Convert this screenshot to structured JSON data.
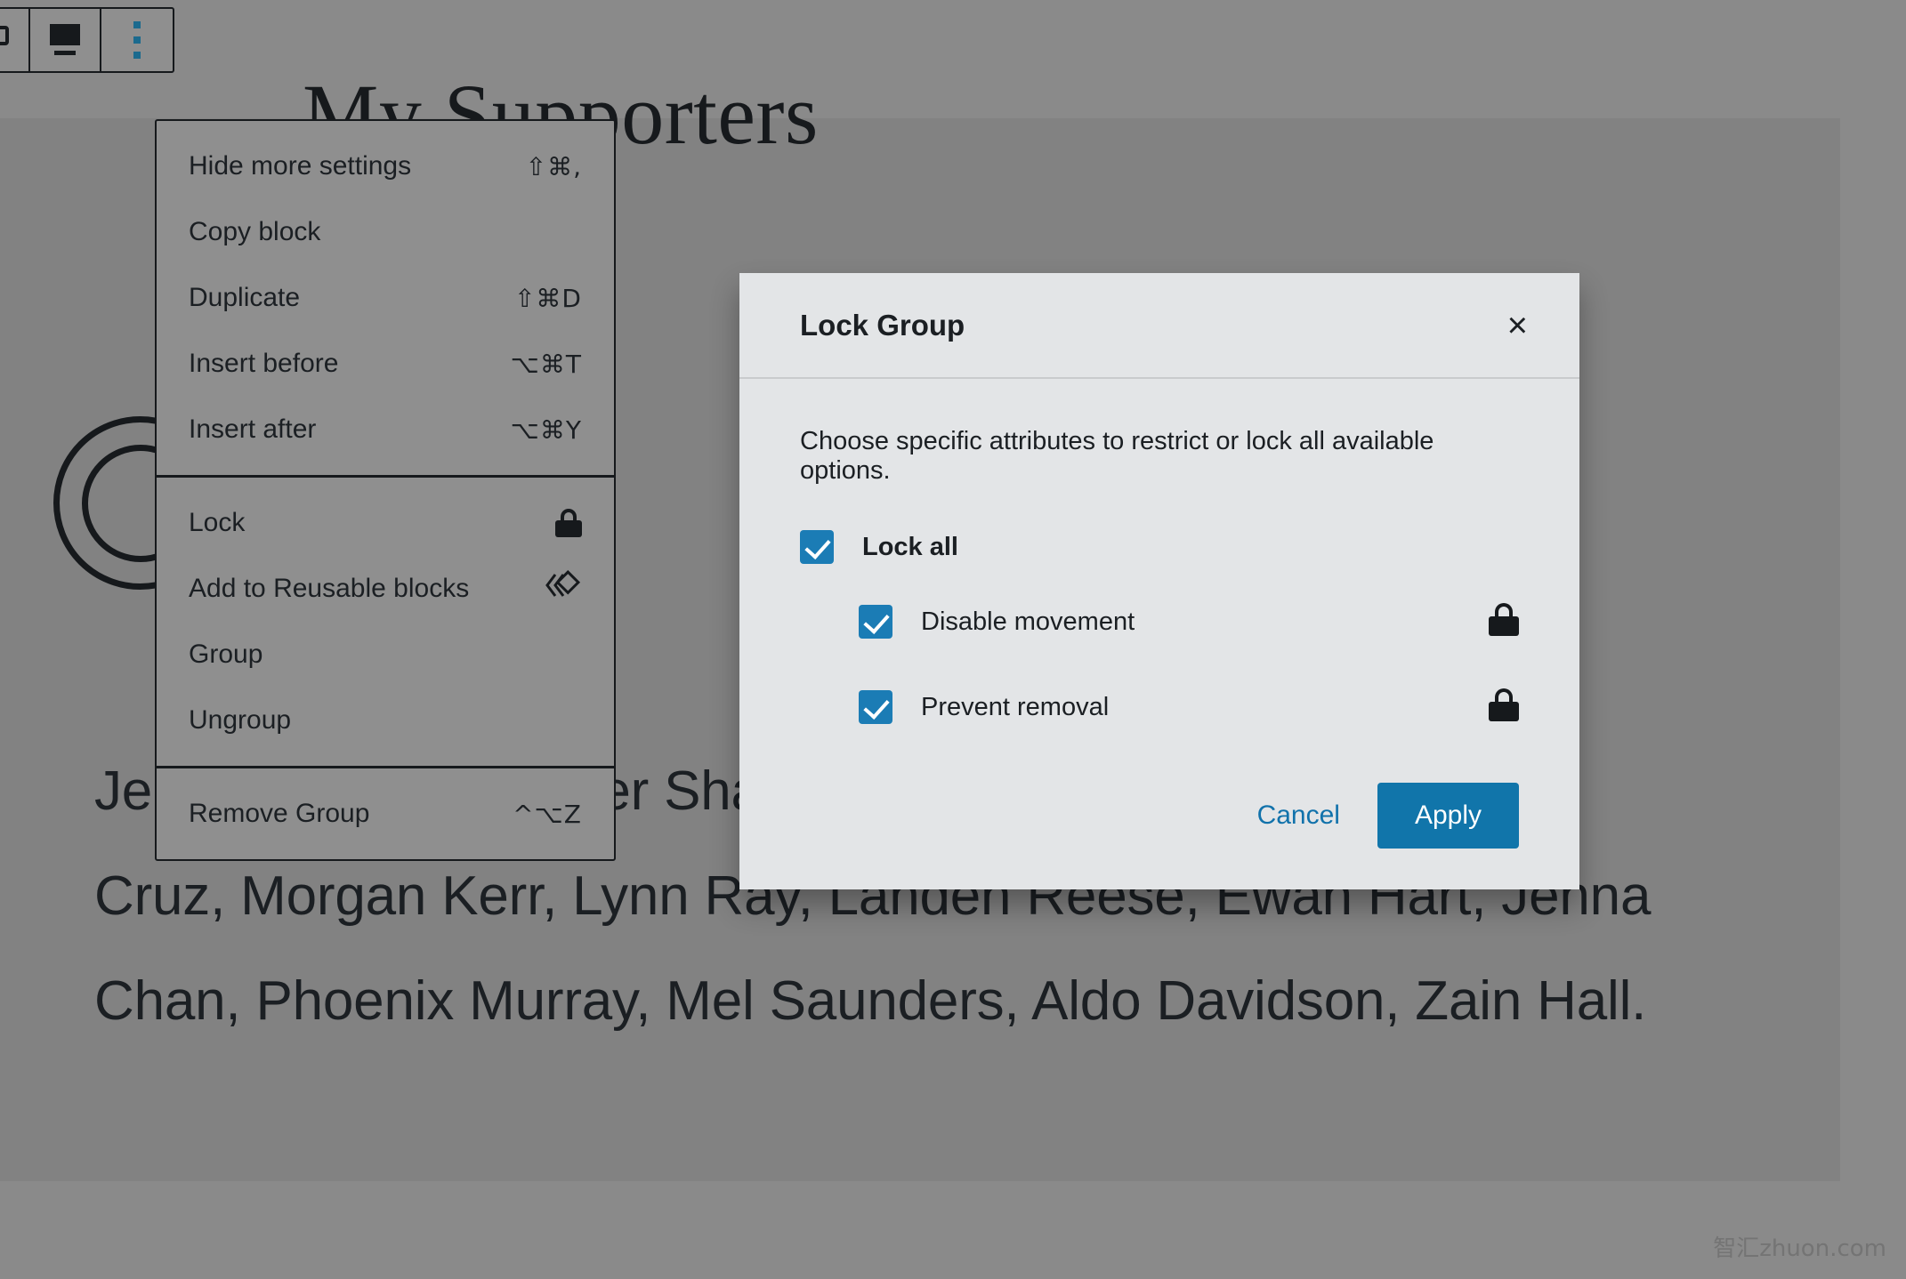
{
  "editor": {
    "page_title": "My Supporters",
    "supporters_paragraph": "Jensen Douglas, Peter Shaw, Ang Jensen, Boston Bell, Shay Cruz, Morgan Kerr, Lynn Ray, Landen Reese, Ewan Hart, Jenna Chan, Phoenix Murray, Mel Saunders, Aldo Davidson, Zain Hall."
  },
  "toolbar": {
    "buttons": [
      {
        "name": "select-parent-block-button",
        "icon": "group-blocks-icon"
      },
      {
        "name": "change-alignment-button",
        "icon": "align-icon"
      },
      {
        "name": "block-options-button",
        "icon": "vertical-dots-icon"
      }
    ]
  },
  "block_menu": {
    "sections": [
      {
        "items": [
          {
            "label": "Hide more settings",
            "shortcut": "⇧⌘,"
          },
          {
            "label": "Copy block",
            "shortcut": ""
          },
          {
            "label": "Duplicate",
            "shortcut": "⇧⌘D"
          },
          {
            "label": "Insert before",
            "shortcut": "⌥⌘T"
          },
          {
            "label": "Insert after",
            "shortcut": "⌥⌘Y"
          }
        ]
      },
      {
        "items": [
          {
            "label": "Lock",
            "shortcut": "",
            "icon": "lock-icon"
          },
          {
            "label": "Add to Reusable blocks",
            "shortcut": "",
            "icon": "reusable-block-icon"
          },
          {
            "label": "Group",
            "shortcut": ""
          },
          {
            "label": "Ungroup",
            "shortcut": ""
          }
        ]
      },
      {
        "items": [
          {
            "label": "Remove Group",
            "shortcut": "^⌥Z"
          }
        ]
      }
    ]
  },
  "modal": {
    "title": "Lock Group",
    "close_label": "×",
    "description": "Choose specific attributes to restrict or lock all available options.",
    "options": [
      {
        "label": "Lock all",
        "checked": true,
        "has_lock_icon": false
      },
      {
        "label": "Disable movement",
        "checked": true,
        "has_lock_icon": true
      },
      {
        "label": "Prevent removal",
        "checked": true,
        "has_lock_icon": true
      }
    ],
    "cancel_label": "Cancel",
    "apply_label": "Apply"
  },
  "watermark": {
    "text": "智汇zhuon.com"
  },
  "colors": {
    "accent_blue": "#1b7cb5",
    "button_blue": "#1175aa",
    "link_blue": "#1172ab",
    "modal_bg": "#e3e5e7",
    "canvas_bg": "#8a8a8a",
    "panel_bg": "#828282",
    "menu_bg": "#8f8f8f",
    "text_dark": "#1b1f23"
  }
}
